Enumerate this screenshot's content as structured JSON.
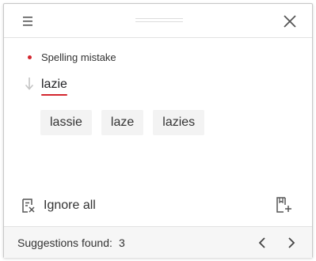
{
  "header": {
    "menu_icon": "hamburger-menu-icon",
    "close_icon": "close-icon"
  },
  "mistake": {
    "category": "Spelling mistake",
    "category_color": "#d3262e",
    "word": "lazie",
    "underline_color": "#d3262e"
  },
  "suggestions": [
    "lassie",
    "laze",
    "lazies"
  ],
  "actions": {
    "ignore_all_label": "Ignore all",
    "ignore_icon": "ignore-document-icon",
    "add_to_dictionary_icon": "add-to-dictionary-icon"
  },
  "footer": {
    "found_label": "Suggestions found:",
    "found_count": "3",
    "prev_icon": "chevron-left-icon",
    "next_icon": "chevron-right-icon"
  }
}
